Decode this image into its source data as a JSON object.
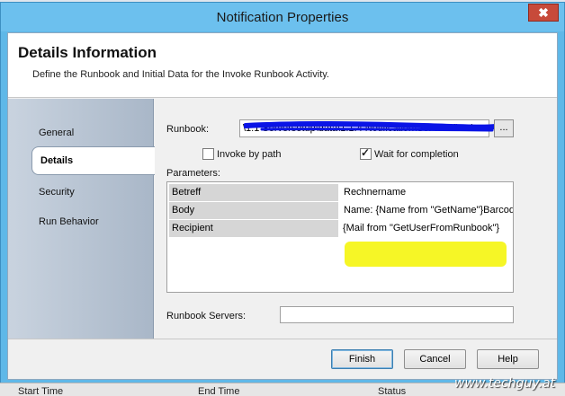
{
  "window": {
    "title": "Notification Properties",
    "close_glyph": "✖"
  },
  "header": {
    "title": "Details Information",
    "description": "Define the Runbook and Initial Data for the Invoke Runbook Activity."
  },
  "nav": {
    "items": [
      {
        "label": "General",
        "selected": false
      },
      {
        "label": "Details",
        "selected": true
      },
      {
        "label": "Security",
        "selected": false
      },
      {
        "label": "Run Behavior",
        "selected": false
      }
    ]
  },
  "form": {
    "runbook_label": "Runbook:",
    "runbook_value": "\\1.1 Serversetup\\data\\1.1.4 Notification\\Ser Notification",
    "browse_label": "...",
    "invoke_by_path_label": "Invoke by path",
    "invoke_by_path_checked": false,
    "wait_for_completion_label": "Wait for completion",
    "wait_for_completion_checked": true,
    "parameters_label": "Parameters:",
    "parameters": [
      {
        "name": "Betreff",
        "value": "Rechnername"
      },
      {
        "name": "Body",
        "value": "Name: {Name from \"GetName\"}Barcode"
      },
      {
        "name": "Recipient",
        "value": "{Mail from \"GetUserFromRunbook\"}"
      }
    ],
    "runbook_servers_label": "Runbook Servers:",
    "runbook_servers_value": ""
  },
  "buttons": {
    "finish": "Finish",
    "cancel": "Cancel",
    "help": "Help"
  },
  "background": {
    "columns": [
      "Start Time",
      "End Time",
      "Status"
    ]
  },
  "watermark": "www.techguy.at",
  "colors": {
    "titlebar": "#6cc0ee",
    "annotation_scribble": "#0a14e6",
    "annotation_highlight": "#f5f500"
  }
}
